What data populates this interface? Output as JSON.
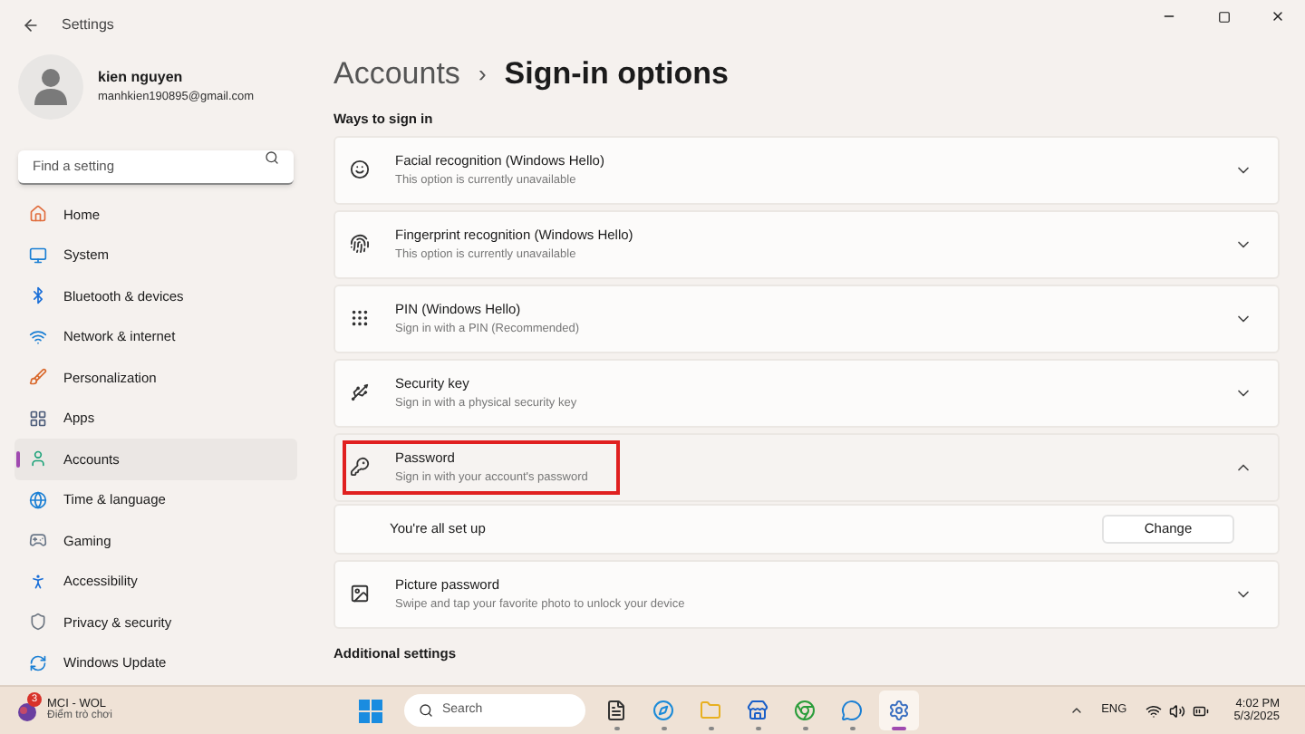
{
  "window": {
    "title": "Settings"
  },
  "profile": {
    "name": "kien nguyen",
    "email": "manhkien190895@gmail.com"
  },
  "search": {
    "placeholder": "Find a setting"
  },
  "nav": [
    {
      "label": "Home",
      "selected": false
    },
    {
      "label": "System",
      "selected": false
    },
    {
      "label": "Bluetooth & devices",
      "selected": false
    },
    {
      "label": "Network & internet",
      "selected": false
    },
    {
      "label": "Personalization",
      "selected": false
    },
    {
      "label": "Apps",
      "selected": false
    },
    {
      "label": "Accounts",
      "selected": true
    },
    {
      "label": "Time & language",
      "selected": false
    },
    {
      "label": "Gaming",
      "selected": false
    },
    {
      "label": "Accessibility",
      "selected": false
    },
    {
      "label": "Privacy & security",
      "selected": false
    },
    {
      "label": "Windows Update",
      "selected": false
    }
  ],
  "breadcrumb": {
    "parent": "Accounts",
    "separator": "›",
    "current": "Sign-in options"
  },
  "section_title": "Ways to sign in",
  "options": [
    {
      "title": "Facial recognition (Windows Hello)",
      "subtitle": "This option is currently unavailable",
      "expanded": false,
      "highlighted": false
    },
    {
      "title": "Fingerprint recognition (Windows Hello)",
      "subtitle": "This option is currently unavailable",
      "expanded": false,
      "highlighted": false
    },
    {
      "title": "PIN (Windows Hello)",
      "subtitle": "Sign in with a PIN (Recommended)",
      "expanded": false,
      "highlighted": false
    },
    {
      "title": "Security key",
      "subtitle": "Sign in with a physical security key",
      "expanded": false,
      "highlighted": false
    },
    {
      "title": "Password",
      "subtitle": "Sign in with your account's password",
      "expanded": true,
      "highlighted": true,
      "detail": "You're all set up",
      "action": "Change"
    },
    {
      "title": "Picture password",
      "subtitle": "Swipe and tap your favorite photo to unlock your device",
      "expanded": false,
      "highlighted": false
    }
  ],
  "additional_title": "Additional settings",
  "taskbar": {
    "widget": {
      "title": "MCI - WOL",
      "subtitle": "Điểm trò chơi",
      "badge": "3"
    },
    "search": "Search",
    "apps": [
      {
        "selected": false
      },
      {
        "selected": false
      },
      {
        "selected": false
      },
      {
        "selected": false
      },
      {
        "selected": false
      },
      {
        "selected": false
      },
      {
        "selected": true
      }
    ],
    "language": "ENG",
    "time": "4:02 PM",
    "date": "5/3/2025"
  }
}
